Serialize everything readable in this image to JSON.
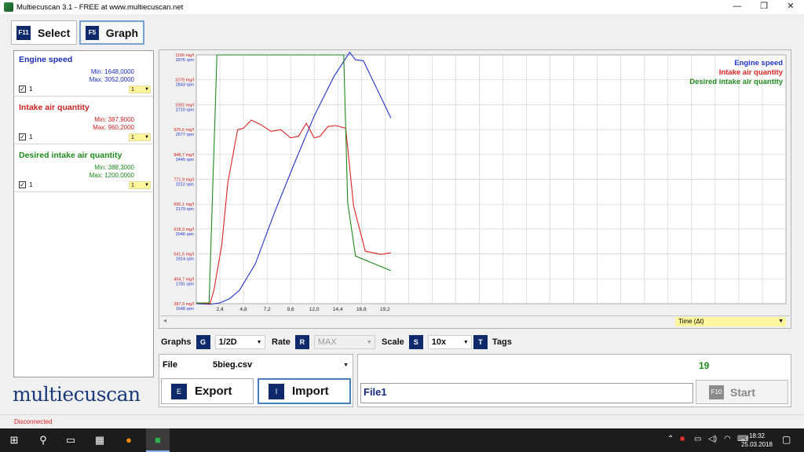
{
  "window": {
    "title": "Multiecuscan 3.1 - FREE at www.multiecuscan.net",
    "minimize": "—",
    "maximize": "❐",
    "close": "✕"
  },
  "tabs": [
    {
      "key": "F11",
      "label": "Select"
    },
    {
      "key": "F5",
      "label": "Graph"
    }
  ],
  "params": [
    {
      "name": "Engine speed",
      "min": "Min: 1648,0000",
      "max": "Max: 3052,0000",
      "checked": "✓",
      "count": "1",
      "option": "1",
      "color": "#1a2db4"
    },
    {
      "name": "Intake air quantity",
      "min": "Min: 387,9000",
      "max": "Max: 960,2000",
      "checked": "✓",
      "count": "1",
      "option": "1",
      "color": "#cc2222"
    },
    {
      "name": "Desired intake air quantity",
      "min": "Min: 388,3000",
      "max": "Max: 1200,0000",
      "checked": "✓",
      "count": "1",
      "option": "1",
      "color": "#1e8a1e"
    }
  ],
  "brand": "multiecuscan",
  "controls": {
    "graphs_label": "Graphs",
    "graphs_key": "G",
    "graphs_value": "1/2D",
    "rate_label": "Rate",
    "rate_key": "R",
    "rate_value": "MAX",
    "scale_label": "Scale",
    "scale_key": "S",
    "scale_value": "10x",
    "tags_key": "T",
    "tags_label": "Tags"
  },
  "file": {
    "label": "File",
    "value": "5bieg.csv"
  },
  "buttons": {
    "export_key": "E",
    "export_label": "Export",
    "import_key": "I",
    "import_label": "Import",
    "start_key": "F10",
    "start_label": "Start"
  },
  "run": {
    "count": "19",
    "name": "File1"
  },
  "time_select": "Time (Δt)",
  "status": "Disconnected",
  "clock": {
    "time": "18:32",
    "date": "25.03.2018"
  },
  "chart_data": {
    "type": "line",
    "legend": [
      "Engine speed",
      "Intake air quantity",
      "Desired intake air quantity"
    ],
    "legend_placement": "top-right",
    "grid": true,
    "x_ticks": [
      "2,4",
      "4,8",
      "7,2",
      "9,6",
      "12,0",
      "14,4",
      "16,8",
      "19,2"
    ],
    "y_ticks_left": [
      {
        "mg": "1156 mg/l",
        "rpm": "2976 rpm"
      },
      {
        "mg": "1079 mg/l",
        "rpm": "2843 rpm"
      },
      {
        "mg": "1002 mg/l",
        "rpm": "2710 rpm"
      },
      {
        "mg": "925,6 mg/l",
        "rpm": "2577 rpm"
      },
      {
        "mg": "848,7 mg/l",
        "rpm": "2445 rpm"
      },
      {
        "mg": "771,9 mg/l",
        "rpm": "2312 rpm"
      },
      {
        "mg": "695,1 mg/l",
        "rpm": "2179 rpm"
      },
      {
        "mg": "618,3 mg/l",
        "rpm": "2046 rpm"
      },
      {
        "mg": "541,5 mg/l",
        "rpm": "1914 rpm"
      },
      {
        "mg": "464,7 mg/l",
        "rpm": "1781 rpm"
      },
      {
        "mg": "387,9 mg/l",
        "rpm": "1648 rpm"
      }
    ],
    "x_range": [
      0,
      60
    ],
    "mg_range": [
      387.9,
      1156
    ],
    "rpm_range": [
      1648,
      2976
    ],
    "series": [
      {
        "name": "Engine speed",
        "color": "#2233cc",
        "axis": "rpm",
        "x": [
          0,
          1.4,
          2.4,
          3.4,
          4.4,
          6.0,
          8.0,
          10.0,
          12.0,
          14.0,
          15.6,
          16.2,
          17.0,
          19.8
        ],
        "y": [
          1648,
          1645,
          1652,
          1675,
          1720,
          1860,
          2140,
          2400,
          2650,
          2860,
          2990,
          2950,
          2945,
          2640
        ]
      },
      {
        "name": "Intake air quantity",
        "color": "#dd2222",
        "axis": "mg",
        "x": [
          0,
          1.4,
          1.8,
          2.6,
          3.2,
          4.2,
          4.8,
          5.6,
          6.6,
          7.6,
          8.6,
          9.6,
          10.4,
          11.2,
          12.0,
          12.6,
          13.4,
          14.2,
          15.2,
          16.0,
          17.2,
          18.8,
          19.8
        ],
        "y": [
          390,
          388,
          430,
          570,
          760,
          925,
          930,
          955,
          940,
          920,
          925,
          900,
          905,
          945,
          900,
          905,
          935,
          938,
          930,
          690,
          550,
          540,
          545
        ]
      },
      {
        "name": "Desired intake air quantity",
        "color": "#1e8a1e",
        "axis": "mg",
        "x": [
          0,
          1.3,
          2.1,
          15.0,
          15.4,
          16.2,
          19.8
        ],
        "y": [
          390,
          390,
          1156,
          1156,
          700,
          535,
          490
        ]
      }
    ]
  }
}
